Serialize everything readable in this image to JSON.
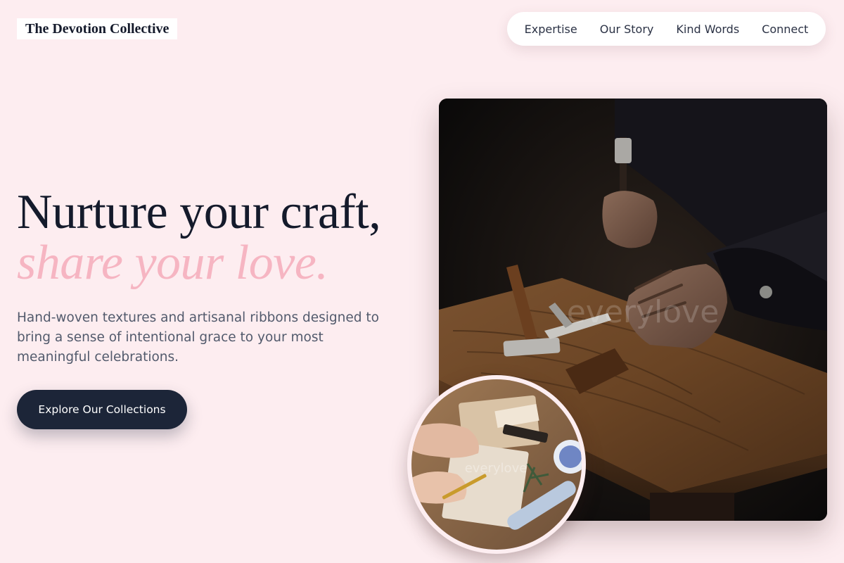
{
  "brand": {
    "name": "The Devotion Collective"
  },
  "nav": {
    "items": [
      {
        "label": "Expertise"
      },
      {
        "label": "Our Story"
      },
      {
        "label": "Kind Words"
      },
      {
        "label": "Connect"
      }
    ]
  },
  "hero": {
    "headline_line1": "Nurture your craft,",
    "headline_line2": "share your love.",
    "subtitle": "Hand-woven textures and artisanal ribbons designed to bring a sense of intentional grace to your most meaningful celebrations.",
    "cta_label": "Explore Our Collections"
  },
  "images": {
    "main_watermark": "everylove",
    "small_watermark": "everylove"
  },
  "colors": {
    "background": "#fdedf0",
    "ink": "#141a2b",
    "accent_pink": "#f6b5c2",
    "button": "#1c2538"
  }
}
